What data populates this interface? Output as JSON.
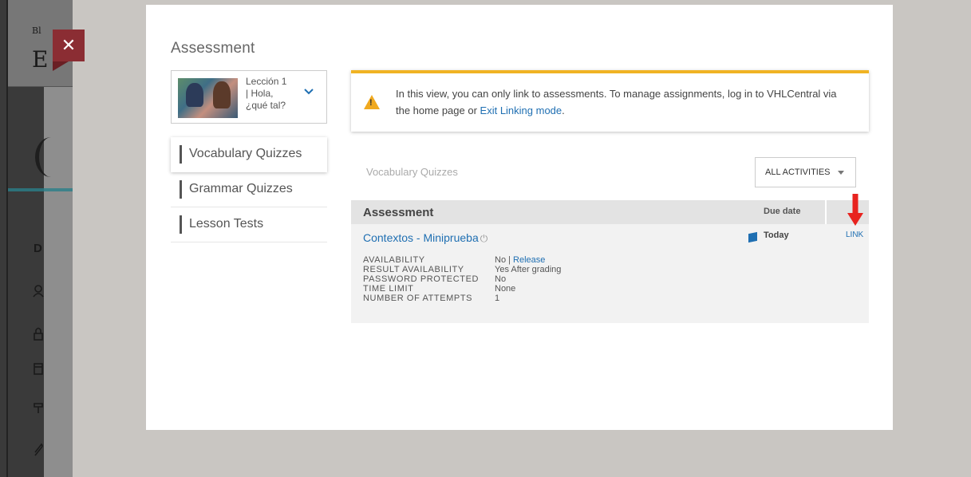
{
  "background_app": {
    "glyphs": [
      "Bl",
      "E",
      "D"
    ],
    "colors": {
      "teal": "#2a7f8a"
    }
  },
  "close_button": {
    "label": "✕",
    "color": "#8b2d33"
  },
  "modal": {
    "title": "Assessment",
    "lesson_selector": {
      "line1": "Lección 1",
      "line2": "| Hola,",
      "line3": "¿qué tal?",
      "icon": "chevron-down-icon"
    },
    "side_nav": [
      {
        "label": "Vocabulary Quizzes",
        "active": true
      },
      {
        "label": "Grammar Quizzes",
        "active": false
      },
      {
        "label": "Lesson Tests",
        "active": false
      }
    ],
    "notice": {
      "icon": "warning-icon",
      "accent": "#f0b323",
      "text_before": "In this view, you can only link to assessments. To manage assignments, log in to VHLCentral via the home page or ",
      "link_text": "Exit Linking mode",
      "text_after": "."
    },
    "section_label": "Vocabulary Quizzes",
    "filter": {
      "selected": "ALL ACTIVITIES"
    },
    "table": {
      "headers": {
        "assessment": "Assessment",
        "due_date": "Due date"
      },
      "rows": [
        {
          "title": "Contextos - Miniprueba",
          "due": "Today",
          "action": "LINK",
          "details": [
            {
              "key": "AVAILABILITY",
              "value": "No",
              "link": "Release"
            },
            {
              "key": "RESULT AVAILABILITY",
              "value": "Yes After grading"
            },
            {
              "key": "PASSWORD PROTECTED",
              "value": "No"
            },
            {
              "key": "TIME LIMIT",
              "value": "None"
            },
            {
              "key": "NUMBER OF ATTEMPTS",
              "value": "1"
            }
          ]
        }
      ]
    }
  },
  "colors": {
    "link": "#1f6fb2",
    "arrow": "#e8231f",
    "warning": "#f0a91f"
  }
}
